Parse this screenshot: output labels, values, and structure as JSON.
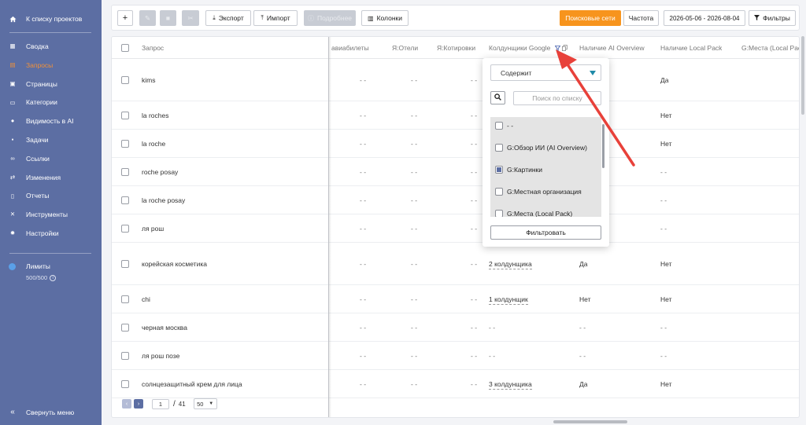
{
  "sidebar": {
    "back_label": "К списку проектов",
    "items": [
      {
        "label": "Сводка",
        "icon": "dashboard-icon",
        "active": false
      },
      {
        "label": "Запросы",
        "icon": "list-icon",
        "active": true
      },
      {
        "label": "Страницы",
        "icon": "pages-icon",
        "active": false
      },
      {
        "label": "Категории",
        "icon": "folder-icon",
        "active": false
      },
      {
        "label": "Видимость в AI",
        "icon": "location-pin-icon",
        "active": false
      },
      {
        "label": "Задачи",
        "icon": "tasks-icon",
        "active": false
      },
      {
        "label": "Ссылки",
        "icon": "link-icon",
        "active": false
      },
      {
        "label": "Изменения",
        "icon": "changes-icon",
        "active": false
      },
      {
        "label": "Отчеты",
        "icon": "report-icon",
        "active": false
      },
      {
        "label": "Инструменты",
        "icon": "tools-icon",
        "active": false
      },
      {
        "label": "Настройки",
        "icon": "settings-gear-icon",
        "active": false
      }
    ],
    "limits_label": "Лимиты",
    "limits_value": "500/500",
    "collapse_label": "Свернуть меню"
  },
  "toolbar": {
    "export_label": "Экспорт",
    "import_label": "Импорт",
    "more_label": "Подробнее",
    "columns_label": "Колонки",
    "search_networks_label": "Поисковые сети",
    "frequency_label": "Частота",
    "date_range": "2026-05-06 - 2026-08-04",
    "filters_label": "Фильтры"
  },
  "table": {
    "columns": [
      "Запрос",
      "авиабилеты",
      "Я:Отели",
      "Я:Котировки",
      "Колдунщики Google",
      "Наличие AI Overview",
      "Наличие Local Pack",
      "G:Места (Local Pac"
    ],
    "rows": [
      {
        "query": "kims",
        "c1": "- -",
        "c2": "- -",
        "c3": "- -",
        "c4": "",
        "c5": "",
        "c6": "Да"
      },
      {
        "query": "la roches",
        "c1": "- -",
        "c2": "- -",
        "c3": "- -",
        "c4": "",
        "c5": "",
        "c6": "Нет"
      },
      {
        "query": "la roche",
        "c1": "- -",
        "c2": "- -",
        "c3": "- -",
        "c4": "",
        "c5": "",
        "c6": "Нет"
      },
      {
        "query": "roche posay",
        "c1": "- -",
        "c2": "- -",
        "c3": "- -",
        "c4": "",
        "c5": "",
        "c6": "- -"
      },
      {
        "query": "la roche posay",
        "c1": "- -",
        "c2": "- -",
        "c3": "- -",
        "c4": "",
        "c5": "",
        "c6": "- -"
      },
      {
        "query": "ля рош",
        "c1": "- -",
        "c2": "- -",
        "c3": "- -",
        "c4": "",
        "c5": "",
        "c6": "- -"
      },
      {
        "query": "корейская косметика",
        "c1": "- -",
        "c2": "- -",
        "c3": "- -",
        "c4": "2 колдунщика",
        "c5": "Да",
        "c6": "Нет"
      },
      {
        "query": "chi",
        "c1": "- -",
        "c2": "- -",
        "c3": "- -",
        "c4": "1 колдунщик",
        "c5": "Нет",
        "c6": "Нет"
      },
      {
        "query": "черная москва",
        "c1": "- -",
        "c2": "- -",
        "c3": "- -",
        "c4": "- -",
        "c5": "- -",
        "c6": "- -"
      },
      {
        "query": "ля рош позе",
        "c1": "- -",
        "c2": "- -",
        "c3": "- -",
        "c4": "- -",
        "c5": "- -",
        "c6": "- -"
      },
      {
        "query": "солнцезащитный крем для лица",
        "c1": "- -",
        "c2": "- -",
        "c3": "- -",
        "c4": "3 колдунщика",
        "c5": "Да",
        "c6": "Нет"
      }
    ]
  },
  "pagination": {
    "page": "1",
    "sep": "/",
    "total": "41",
    "per_page": "50"
  },
  "filter_dropdown": {
    "mode": "Содержит",
    "search_placeholder": "Поиск по списку",
    "options": [
      {
        "label": "- -",
        "checked": false
      },
      {
        "label": "G:Обзор ИИ (AI Overview)",
        "checked": false
      },
      {
        "label": "G:Картинки",
        "checked": true
      },
      {
        "label": "G:Местная организация",
        "checked": false
      },
      {
        "label": "G:Места (Local Pack)",
        "checked": false
      }
    ],
    "apply_label": "Фильтровать"
  },
  "colors": {
    "sidebar": "#5c6ea3",
    "accent": "#f7941d",
    "arrow": "#e8413a"
  }
}
